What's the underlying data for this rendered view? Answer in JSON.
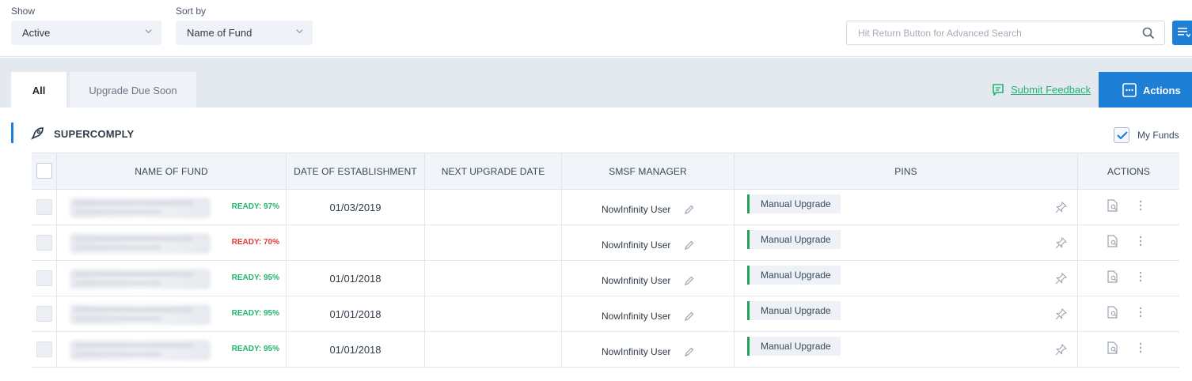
{
  "filters": {
    "show_label": "Show",
    "show_value": "Active",
    "sort_label": "Sort by",
    "sort_value": "Name of Fund",
    "search_placeholder": "Hit Return Button for Advanced Search"
  },
  "tabs": [
    {
      "label": "All",
      "active": true
    },
    {
      "label": "Upgrade Due Soon",
      "active": false
    }
  ],
  "toolbar": {
    "feedback_label": "Submit Feedback",
    "actions_label": "Actions"
  },
  "section": {
    "title": "SUPERCOMPLY",
    "my_funds_label": "My Funds",
    "my_funds_checked": true
  },
  "table": {
    "columns": [
      "NAME OF FUND",
      "DATE OF ESTABLISHMENT",
      "NEXT UPGRADE DATE",
      "SMSF MANAGER",
      "PINS",
      "ACTIONS"
    ],
    "rows": [
      {
        "ready": "READY: 97%",
        "ready_color": "#1fb56b",
        "established": "01/03/2019",
        "next_upgrade": "",
        "manager": "NowInfinity User",
        "pin": "Manual Upgrade"
      },
      {
        "ready": "READY: 70%",
        "ready_color": "#e53935",
        "established": "",
        "next_upgrade": "",
        "manager": "NowInfinity User",
        "pin": "Manual Upgrade"
      },
      {
        "ready": "READY: 95%",
        "ready_color": "#1fb56b",
        "established": "01/01/2018",
        "next_upgrade": "",
        "manager": "NowInfinity User",
        "pin": "Manual Upgrade"
      },
      {
        "ready": "READY: 95%",
        "ready_color": "#1fb56b",
        "established": "01/01/2018",
        "next_upgrade": "",
        "manager": "NowInfinity User",
        "pin": "Manual Upgrade"
      },
      {
        "ready": "READY: 95%",
        "ready_color": "#1fb56b",
        "established": "01/01/2018",
        "next_upgrade": "",
        "manager": "NowInfinity User",
        "pin": "Manual Upgrade"
      }
    ]
  },
  "colors": {
    "primary": "#1e7fd6",
    "success": "#1fb56b",
    "danger": "#e53935",
    "band": "#e4e8ef"
  },
  "icons": {
    "select_chevron": "chevron-down-icon",
    "search": "search-icon",
    "advanced": "filter-list-icon",
    "feedback": "chat-icon",
    "actions": "dots-square-icon",
    "section": "rocket-icon",
    "edit": "pencil-icon",
    "pin": "pin-icon",
    "document": "document-search-icon",
    "more": "kebab-icon"
  }
}
